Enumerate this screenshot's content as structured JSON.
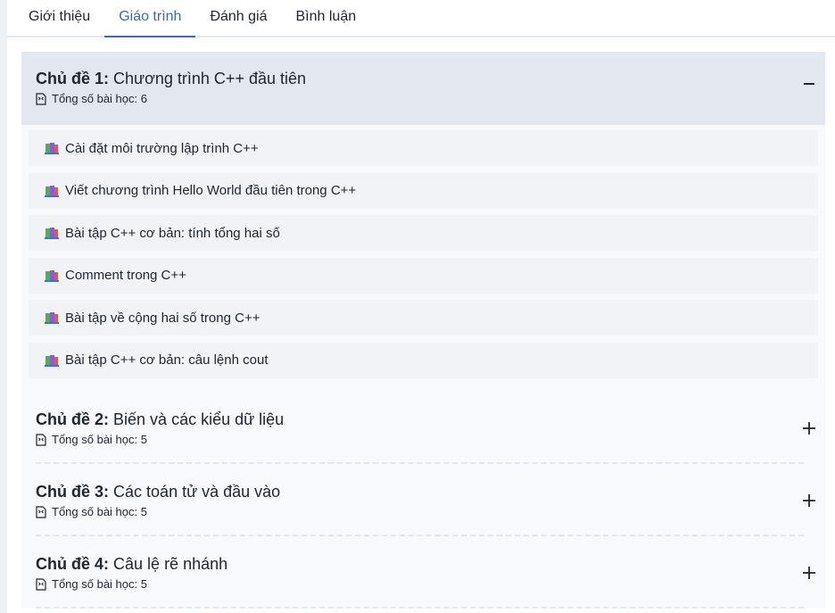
{
  "tabs": [
    {
      "label": "Giới thiệu"
    },
    {
      "label": "Giáo trình"
    },
    {
      "label": "Đánh giá"
    },
    {
      "label": "Bình luận"
    }
  ],
  "active_tab": "Giáo trình",
  "colors": {
    "accent": "#3a6aa8",
    "open_header_bg": "#e3e7ef",
    "lesson_bg": "#f1f3f7"
  },
  "topics": [
    {
      "prefix": "Chủ đề 1:",
      "title": "Chương trình C++ đầu tiên",
      "count": "Tổng số bài học: 6",
      "expanded": true,
      "lessons": [
        "Cài đặt môi trường lập trình C++",
        "Viết chương trình Hello World đầu tiên trong C++",
        "Bài tập C++ cơ bản: tính tổng hai số",
        "Comment trong C++",
        "Bài tập về cộng hai số trong C++",
        "Bài tập C++ cơ bản: câu lệnh cout"
      ]
    },
    {
      "prefix": "Chủ đề 2:",
      "title": "Biến và các kiểu dữ liệu",
      "count": "Tổng số bài học: 5",
      "expanded": false
    },
    {
      "prefix": "Chủ đề 3:",
      "title": "Các toán tử và đầu vào",
      "count": "Tổng số bài học: 5",
      "expanded": false
    },
    {
      "prefix": "Chủ đề 4:",
      "title": "Câu lệ rẽ nhánh",
      "count": "Tổng số bài học: 5",
      "expanded": false
    }
  ],
  "icons": {
    "document": "document-icon",
    "lesson": "book-icon",
    "collapse": "minus-icon",
    "expand": "plus-icon"
  }
}
